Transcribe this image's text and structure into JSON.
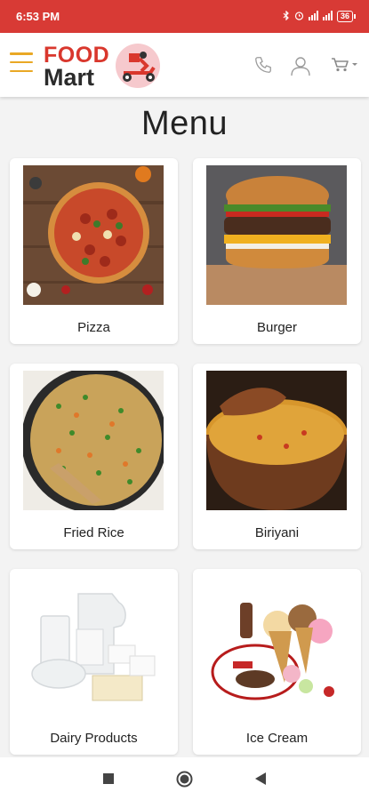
{
  "status_bar": {
    "time": "6:53 PM",
    "battery": "36"
  },
  "header": {
    "logo_top": "FOOD",
    "logo_bottom": "Mart",
    "icons": [
      "hamburger-menu-icon",
      "phone-icon",
      "user-icon",
      "cart-icon"
    ]
  },
  "page": {
    "title": "Menu"
  },
  "menu": {
    "items": [
      {
        "label": "Pizza"
      },
      {
        "label": "Burger"
      },
      {
        "label": "Fried Rice"
      },
      {
        "label": "Biriyani"
      },
      {
        "label": "Dairy Products"
      },
      {
        "label": "Ice Cream"
      }
    ]
  },
  "colors": {
    "status_bar": "#d83a35",
    "accent": "#e9a825",
    "logo_red": "#d9372d"
  }
}
